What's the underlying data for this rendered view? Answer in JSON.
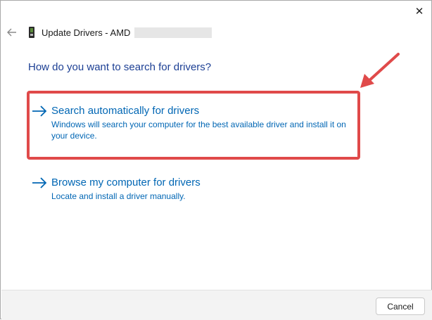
{
  "window": {
    "title": "Update Drivers - AMD",
    "close_glyph": "✕",
    "back_glyph": "←"
  },
  "prompt": "How do you want to search for drivers?",
  "options": [
    {
      "title": "Search automatically for drivers",
      "description": "Windows will search your computer for the best available driver and install it on your device.",
      "icon": "arrow-right-icon"
    },
    {
      "title": "Browse my computer for drivers",
      "description": "Locate and install a driver manually.",
      "icon": "arrow-right-icon"
    }
  ],
  "footer": {
    "cancel_label": "Cancel"
  },
  "colors": {
    "link": "#0066b4",
    "heading": "#1c3f94",
    "annotation": "#e04a4a"
  }
}
